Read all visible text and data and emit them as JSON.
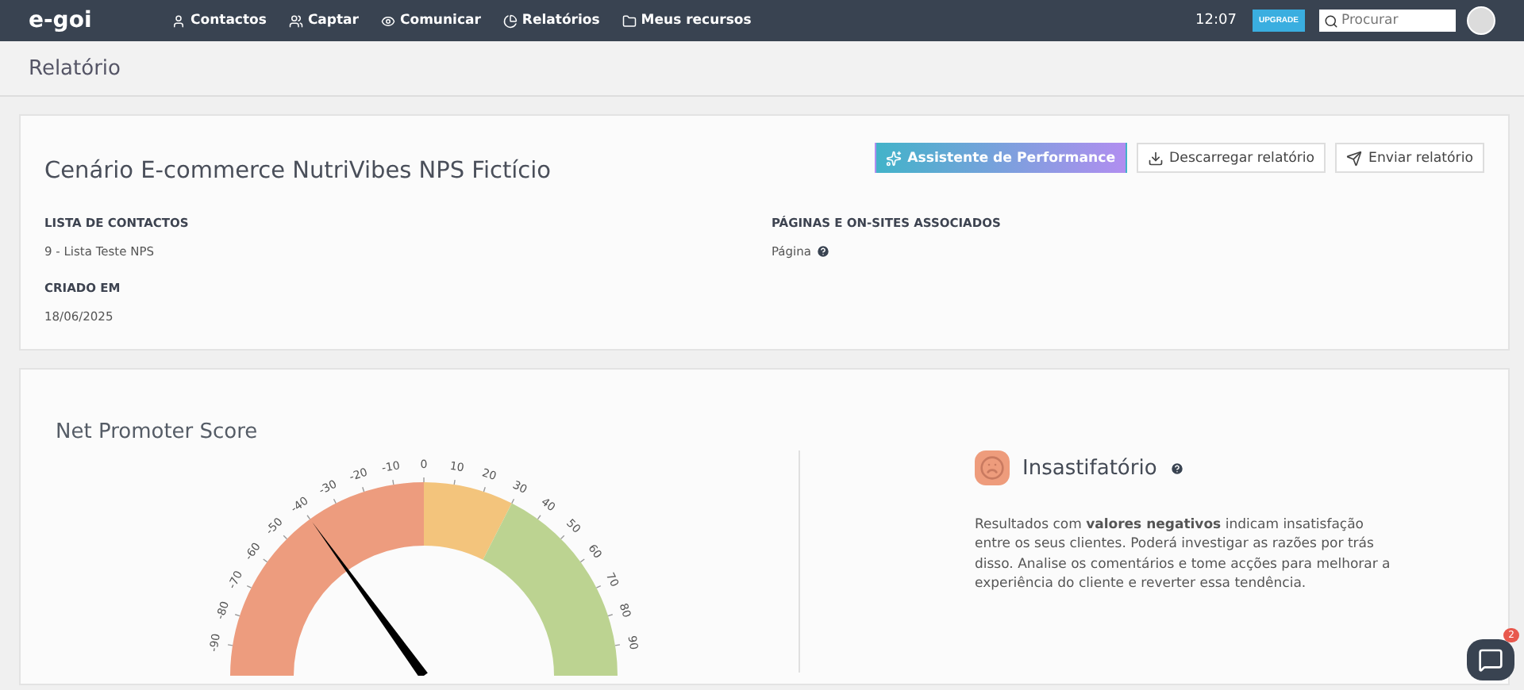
{
  "topbar": {
    "logo": "e-goi",
    "nav": [
      "Contactos",
      "Captar",
      "Comunicar",
      "Relatórios",
      "Meus recursos"
    ],
    "time": "12:07",
    "upgrade": "UPGRADE",
    "search_placeholder": "Procurar"
  },
  "page_title": "Relatório",
  "report": {
    "title": "Cenário E-commerce NutriVibes NPS Fictício",
    "actions": [
      {
        "kind": "primary",
        "label": "Assistente de Performance"
      },
      {
        "kind": "download",
        "label": "Descarregar relatório"
      },
      {
        "kind": "send",
        "label": "Enviar relatório"
      }
    ],
    "fields": [
      {
        "label": "LISTA DE CONTACTOS",
        "value": "9 - Lista Teste NPS",
        "help": false
      },
      {
        "label": "PÁGINAS E ON-SITES ASSOCIADOS",
        "value": "Página",
        "help": true
      },
      {
        "label": "CRIADO EM",
        "value": "18/06/2025",
        "help": false
      }
    ]
  },
  "nps": {
    "title": "Net Promoter Score",
    "gauge": {
      "segments": [
        {
          "color": "#ed9c7e"
        },
        {
          "color": "#f3c47c"
        },
        {
          "color": "#bcd391"
        }
      ],
      "ticks": [
        "-90",
        "-80",
        "-70",
        "-60",
        "-50",
        "-40",
        "-30",
        "-20",
        "-10",
        "0",
        "10",
        "20",
        "30",
        "40",
        "50",
        "60",
        "70",
        "80",
        "90"
      ]
    },
    "verdict": "Insastifatório",
    "description": "Resultados com **valores negativos** indicam insatisfação entre os seus clientes. Poderá investigar as razões por trás disso. Analise os comentários e tome acções para melhorar a experiência do cliente e reverter essa tendência."
  },
  "chat": {
    "badge": "2"
  }
}
